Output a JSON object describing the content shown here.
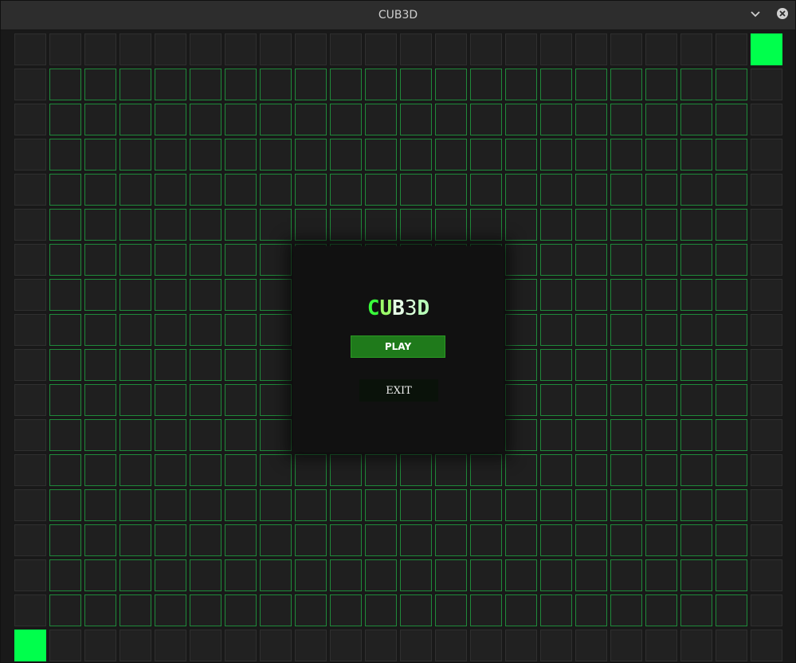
{
  "window": {
    "title": "CUB3D",
    "minimize_icon": "chevron-down-icon",
    "close_icon": "close-icon"
  },
  "menu": {
    "logo_letters": [
      "C",
      "U",
      "B",
      "3",
      "D"
    ],
    "play_label": "PLAY",
    "exit_label": "EXIT"
  },
  "map": {
    "columns": 22,
    "rows": 18,
    "legend": {
      "wall": "border cell",
      "floor": "walkable cell",
      "marker": "highlighted cell"
    },
    "markers": [
      {
        "col": 21,
        "row": 0
      },
      {
        "col": 0,
        "row": 17
      }
    ]
  },
  "colors": {
    "marker": "#00ff4c",
    "floor_border": "#1f8a3a",
    "play_button": "#1f7a1b"
  }
}
